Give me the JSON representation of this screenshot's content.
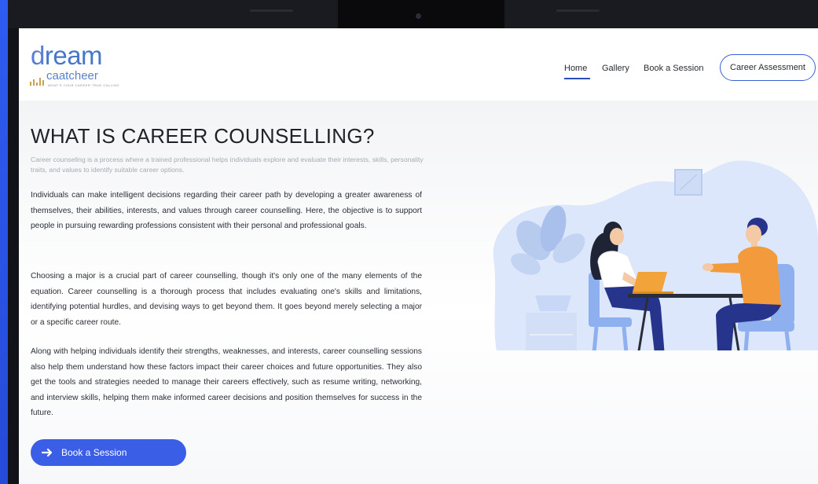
{
  "logo": {
    "word_first": "d",
    "word_rest": "ream",
    "sub": "caatcheer",
    "tagline": "WHAT'S YOUR CAREER TRUE CALLING"
  },
  "nav": {
    "home": "Home",
    "gallery": "Gallery",
    "book": "Book a Session",
    "cta": "Career Assessment"
  },
  "main": {
    "title": "WHAT IS CAREER COUNSELLING?",
    "intro": "Career counseling is a process where a trained professional helps individuals explore and evaluate their interests, skills, personality traits, and values to identify suitable career options.",
    "paragraphs": [
      "Individuals can make intelligent decisions regarding their career path by developing a greater awareness of themselves, their abilities, interests, and values through career counselling. Here, the objective is to support people in pursuing rewarding professions consistent with their personal and professional goals.",
      "Choosing a major is a crucial part of career counselling, though it's only one of the many elements of the equation. Career counselling is a thorough process that includes evaluating one's skills and limitations, identifying potential hurdles, and devising ways to get beyond them. It goes beyond merely selecting a major or a specific career route.",
      "Along with helping individuals identify their strengths, weaknesses, and interests, career counselling sessions also help them understand how these factors impact their career choices and future opportunities. They also get the tools and strategies needed to manage their careers effectively, such as resume writing, networking, and interview skills, helping them make informed career decisions and position themselves for success in the future."
    ],
    "button_label": "Book a Session",
    "button_icon": "arrow-right-icon"
  },
  "illustration": {
    "name": "counselling-session-illustration",
    "colors": {
      "blob": "#dde7fb",
      "chair": "#8fb0ef",
      "shirt_orange": "#f39a3c",
      "pants": "#26348c",
      "laptop": "#f2a33a"
    }
  },
  "colors": {
    "accent": "#3a5ee6",
    "logo_blue": "#4876c9",
    "logo_gold": "#c9a24b"
  }
}
